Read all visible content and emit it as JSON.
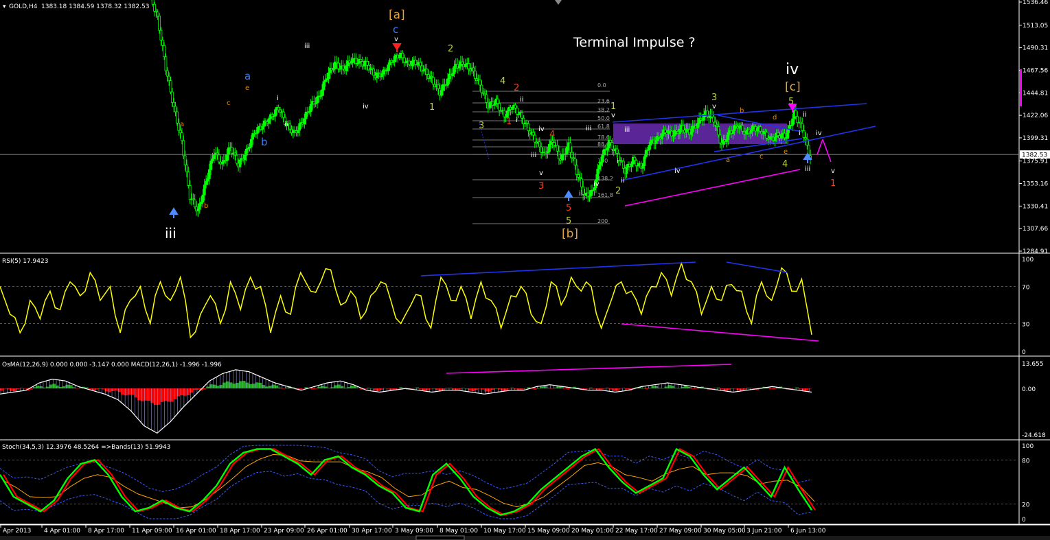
{
  "colors": {
    "background": "#000000",
    "candle": "#00ff00",
    "price_line": "#888888",
    "rsi_line": "#ffff00",
    "macd_pos": "#1faa1f",
    "macd_neg": "#ff0000",
    "macd_signal": "#ffffff",
    "macd_hist": "#9a9ad8",
    "stoch_main": "#00ff00",
    "stoch_signal": "#ff0000",
    "stoch_ma": "#ffa500",
    "bands": "#3a5aff",
    "trend_blue": "#2233ee",
    "trend_magenta": "#ff00ff",
    "box": "#6a2bb0",
    "fib": "#777777"
  },
  "header": {
    "symbol": "GOLD,H4",
    "ohlc": "1383.18 1384.59 1378.32 1382.53"
  },
  "main_title": "Terminal Impulse ?",
  "price_axis": [
    "1536.46",
    "1513.05",
    "1490.31",
    "1467.56",
    "1444.81",
    "1422.06",
    "1399.31",
    "1375.91",
    "1353.16",
    "1330.41",
    "1307.66",
    "1284.91"
  ],
  "current_price": "1382.53",
  "fib_levels": [
    "0.0",
    "23.6",
    "38.2",
    "50.0",
    "61.8",
    "78.6",
    "88.6",
    "100",
    "138.2",
    "161.8",
    "200"
  ],
  "wave_labels": [
    {
      "t": "[a]",
      "c": "#e6a23c",
      "s": 17
    },
    {
      "t": "c",
      "c": "#3a7bff",
      "s": 15
    },
    {
      "t": "v",
      "c": "#ffffff",
      "s": 10
    },
    {
      "t": "a",
      "c": "#3a7bff",
      "s": 15
    },
    {
      "t": "e",
      "c": "#e68a00",
      "s": 10
    },
    {
      "t": "c",
      "c": "#e68a00",
      "s": 10
    },
    {
      "t": "a",
      "c": "#e68a00",
      "s": 10
    },
    {
      "t": "b",
      "c": "#3a7bff",
      "s": 15
    },
    {
      "t": "b",
      "c": "#e68a00",
      "s": 10
    },
    {
      "t": "iii",
      "c": "#ffffff",
      "s": 10
    },
    {
      "t": "i",
      "c": "#ffffff",
      "s": 10
    },
    {
      "t": "ii",
      "c": "#ffffff",
      "s": 10
    },
    {
      "t": "iv",
      "c": "#ffffff",
      "s": 10
    },
    {
      "t": "iii",
      "c": "#ffffff",
      "s": 20
    },
    {
      "t": "2",
      "c": "#bfcf3f",
      "s": 13
    },
    {
      "t": "1",
      "c": "#bfcf3f",
      "s": 13
    },
    {
      "t": "4",
      "c": "#bfcf3f",
      "s": 13
    },
    {
      "t": "3",
      "c": "#bfcf3f",
      "s": 13
    },
    {
      "t": "2",
      "c": "#ff3a10",
      "s": 13
    },
    {
      "t": "1",
      "c": "#ff3a10",
      "s": 13
    },
    {
      "t": "ii",
      "c": "#ffffff",
      "s": 10
    },
    {
      "t": "i",
      "c": "#ffffff",
      "s": 10
    },
    {
      "t": "iv",
      "c": "#ffffff",
      "s": 10
    },
    {
      "t": "iii",
      "c": "#ffffff",
      "s": 10
    },
    {
      "t": "4",
      "c": "#ff3a10",
      "s": 13
    },
    {
      "t": "v",
      "c": "#ffffff",
      "s": 10
    },
    {
      "t": "3",
      "c": "#ff3a10",
      "s": 13
    },
    {
      "t": "5",
      "c": "#ff3a10",
      "s": 13
    },
    {
      "t": "5",
      "c": "#bfcf3f",
      "s": 13
    },
    {
      "t": "[b]",
      "c": "#e6a23c",
      "s": 17
    },
    {
      "t": "ii",
      "c": "#ffffff",
      "s": 10
    },
    {
      "t": "iv",
      "c": "#ffffff",
      "s": 10
    },
    {
      "t": "iii",
      "c": "#ffffff",
      "s": 10
    },
    {
      "t": "1",
      "c": "#bfcf3f",
      "s": 13
    },
    {
      "t": "v",
      "c": "#ffffff",
      "s": 10
    },
    {
      "t": "iii",
      "c": "#ffffff",
      "s": 10
    },
    {
      "t": "i",
      "c": "#ffffff",
      "s": 10
    },
    {
      "t": "ii",
      "c": "#ffffff",
      "s": 10
    },
    {
      "t": "2",
      "c": "#bfcf3f",
      "s": 13
    },
    {
      "t": "iv",
      "c": "#ffffff",
      "s": 10
    },
    {
      "t": "3",
      "c": "#bfcf3f",
      "s": 13
    },
    {
      "t": "v",
      "c": "#ffffff",
      "s": 10
    },
    {
      "t": "b",
      "c": "#e68a00",
      "s": 10
    },
    {
      "t": "a",
      "c": "#e68a00",
      "s": 10
    },
    {
      "t": "c",
      "c": "#e68a00",
      "s": 10
    },
    {
      "t": "d",
      "c": "#e68a00",
      "s": 10
    },
    {
      "t": "e",
      "c": "#e68a00",
      "s": 10
    },
    {
      "t": "4",
      "c": "#bfcf3f",
      "s": 13
    },
    {
      "t": "iv",
      "c": "#ffffff",
      "s": 22
    },
    {
      "t": "[c]",
      "c": "#e6a23c",
      "s": 17
    },
    {
      "t": "5",
      "c": "#bfcf3f",
      "s": 13
    },
    {
      "t": "ii",
      "c": "#ffffff",
      "s": 10
    },
    {
      "t": "i",
      "c": "#ffffff",
      "s": 10
    },
    {
      "t": "iv",
      "c": "#ffffff",
      "s": 10
    },
    {
      "t": "iii",
      "c": "#ffffff",
      "s": 10
    },
    {
      "t": "v",
      "c": "#ffffff",
      "s": 10
    },
    {
      "t": "1",
      "c": "#ff3a10",
      "s": 13
    }
  ],
  "rsi": {
    "label": "RSI(5) 17.9423",
    "levels": [
      "100",
      "70",
      "30",
      "0"
    ]
  },
  "macd": {
    "label": "OsMA(12,26,9) 0.000 0.000 -3.147 0.000  MACD(12,26,1) -1.996 -1.996",
    "levels": [
      "13.655",
      "0.00",
      "-24.618"
    ]
  },
  "stoch": {
    "label": "Stoch(34,5,3) 12.3976 48.5264  =>Bands(13) 51.9943",
    "levels": [
      "100",
      "80",
      "20",
      "0"
    ]
  },
  "time_axis": [
    "Apr 2013",
    "4 Apr 01:00",
    "8 Apr 17:00",
    "11 Apr 09:00",
    "16 Apr 01:00",
    "18 Apr 17:00",
    "23 Apr 09:00",
    "26 Apr 01:00",
    "30 Apr 17:00",
    "3 May 09:00",
    "8 May 01:00",
    "10 May 17:00",
    "15 May 09:00",
    "20 May 01:00",
    "22 May 17:00",
    "27 May 09:00",
    "30 May 05:00",
    "3 Jun 21:00",
    "6 Jun 13:00"
  ],
  "chart_data": [
    {
      "type": "candlestick",
      "symbol": "GOLD",
      "timeframe": "H4",
      "ylim": [
        1284.91,
        1536.46
      ],
      "x_labels": [
        "Apr 2013",
        "4 Apr 01:00",
        "8 Apr 17:00",
        "11 Apr 09:00",
        "16 Apr 01:00",
        "18 Apr 17:00",
        "23 Apr 09:00",
        "26 Apr 01:00",
        "30 Apr 17:00",
        "3 May 09:00",
        "8 May 01:00",
        "10 May 17:00",
        "15 May 09:00",
        "20 May 01:00",
        "22 May 17:00",
        "27 May 09:00",
        "30 May 05:00",
        "3 Jun 21:00",
        "6 Jun 13:00"
      ],
      "close_path": [
        1545,
        1520,
        1470,
        1430,
        1395,
        1340,
        1325,
        1355,
        1385,
        1372,
        1390,
        1372,
        1385,
        1405,
        1412,
        1420,
        1430,
        1412,
        1404,
        1416,
        1432,
        1440,
        1462,
        1474,
        1468,
        1478,
        1476,
        1473,
        1462,
        1465,
        1477,
        1484,
        1474,
        1476,
        1468,
        1458,
        1445,
        1458,
        1472,
        1474,
        1468,
        1452,
        1432,
        1436,
        1421,
        1432,
        1422,
        1408,
        1395,
        1382,
        1397,
        1377,
        1392,
        1365,
        1340,
        1345,
        1378,
        1395,
        1383,
        1366,
        1377,
        1369,
        1394,
        1398,
        1406,
        1403,
        1409,
        1405,
        1414,
        1424,
        1418,
        1392,
        1405,
        1412,
        1404,
        1410,
        1406,
        1398,
        1402,
        1401,
        1424,
        1408,
        1378
      ],
      "current_price": 1382.53
    },
    {
      "type": "line",
      "name": "RSI(5)",
      "ylim": [
        0,
        100
      ],
      "values": [
        70,
        40,
        20,
        55,
        35,
        65,
        45,
        75,
        60,
        85,
        55,
        70,
        20,
        55,
        70,
        30,
        75,
        55,
        80,
        15,
        40,
        60,
        30,
        75,
        45,
        80,
        70,
        20,
        60,
        40,
        85,
        65,
        75,
        88,
        50,
        65,
        35,
        60,
        75,
        55,
        30,
        50,
        60,
        25,
        80,
        55,
        70,
        35,
        75,
        55,
        25,
        60,
        70,
        40,
        30,
        75,
        50,
        80,
        65,
        70,
        25,
        55,
        75,
        65,
        40,
        70,
        85,
        60,
        95,
        75,
        40,
        70,
        55,
        72,
        65,
        30,
        75,
        55,
        90,
        65,
        78,
        18
      ],
      "current": 17.9423
    },
    {
      "type": "bar",
      "name": "OsMA(12,26,9) / MACD(12,26,1)",
      "ylim": [
        -24.618,
        13.655
      ],
      "values": [
        -3,
        -2,
        -1,
        3,
        5,
        4,
        1,
        -1,
        -3,
        -6,
        -12,
        -20,
        -24,
        -18,
        -10,
        -3,
        4,
        8,
        10,
        9,
        6,
        3,
        1,
        -1,
        1,
        3,
        4,
        2,
        -1,
        -2,
        -1,
        0,
        -1,
        -2,
        -1,
        -1,
        -2,
        -3,
        -2,
        -1,
        -1,
        1,
        2,
        1,
        0,
        -1,
        -1,
        -2,
        -1,
        1,
        2,
        3,
        2,
        1,
        0,
        -1,
        -2,
        -1,
        0,
        1,
        0,
        -1,
        -2
      ],
      "macd_current": -1.996
    },
    {
      "type": "line",
      "name": "Stoch(34,5,3)",
      "ylim": [
        0,
        100
      ],
      "series_main": [
        60,
        30,
        20,
        10,
        25,
        55,
        75,
        80,
        60,
        30,
        10,
        15,
        25,
        15,
        10,
        25,
        45,
        75,
        90,
        95,
        95,
        85,
        75,
        60,
        80,
        85,
        70,
        60,
        45,
        35,
        15,
        10,
        60,
        75,
        55,
        30,
        15,
        5,
        10,
        20,
        40,
        55,
        70,
        85,
        95,
        70,
        50,
        35,
        45,
        55,
        95,
        85,
        60,
        40,
        55,
        70,
        50,
        30,
        70,
        40,
        12
      ],
      "signal": 48.5264,
      "bands": 51.9943,
      "current": 12.3976
    }
  ]
}
